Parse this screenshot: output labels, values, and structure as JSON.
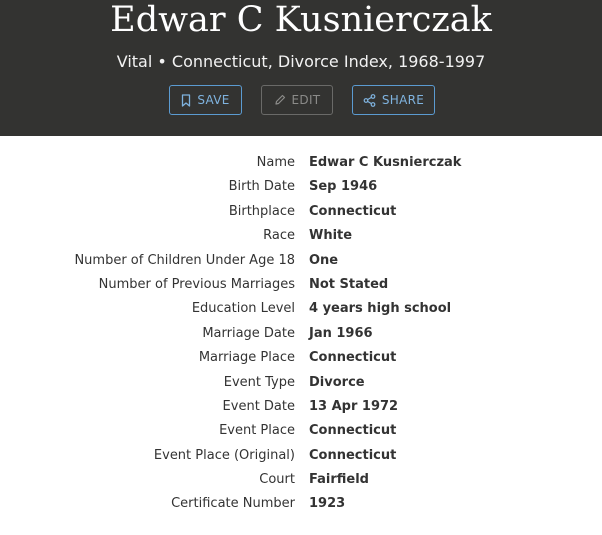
{
  "header": {
    "title": "Edwar C Kusnierczak",
    "subtitle": "Vital • Connecticut, Divorce Index, 1968-1997"
  },
  "actions": {
    "save": {
      "label": "SAVE",
      "icon": "bookmark-icon"
    },
    "edit": {
      "label": "EDIT",
      "icon": "pencil-icon",
      "disabled": true
    },
    "share": {
      "label": "SHARE",
      "icon": "share-icon"
    }
  },
  "colors": {
    "header_bg": "#333331",
    "accent": "#5b9bd1",
    "text": "#333333"
  },
  "details": [
    {
      "label": "Name",
      "value": "Edwar C Kusnierczak"
    },
    {
      "label": "Birth Date",
      "value": "Sep 1946"
    },
    {
      "label": "Birthplace",
      "value": "Connecticut"
    },
    {
      "label": "Race",
      "value": "White"
    },
    {
      "label": "Number of Children Under Age 18",
      "value": "One"
    },
    {
      "label": "Number of Previous Marriages",
      "value": "Not Stated"
    },
    {
      "label": "Education Level",
      "value": "4 years high school"
    },
    {
      "label": "Marriage Date",
      "value": "Jan 1966"
    },
    {
      "label": "Marriage Place",
      "value": "Connecticut"
    },
    {
      "label": "Event Type",
      "value": "Divorce"
    },
    {
      "label": "Event Date",
      "value": "13 Apr 1972"
    },
    {
      "label": "Event Place",
      "value": "Connecticut"
    },
    {
      "label": "Event Place (Original)",
      "value": "Connecticut"
    },
    {
      "label": "Court",
      "value": "Fairfield"
    },
    {
      "label": "Certificate Number",
      "value": "1923"
    }
  ]
}
